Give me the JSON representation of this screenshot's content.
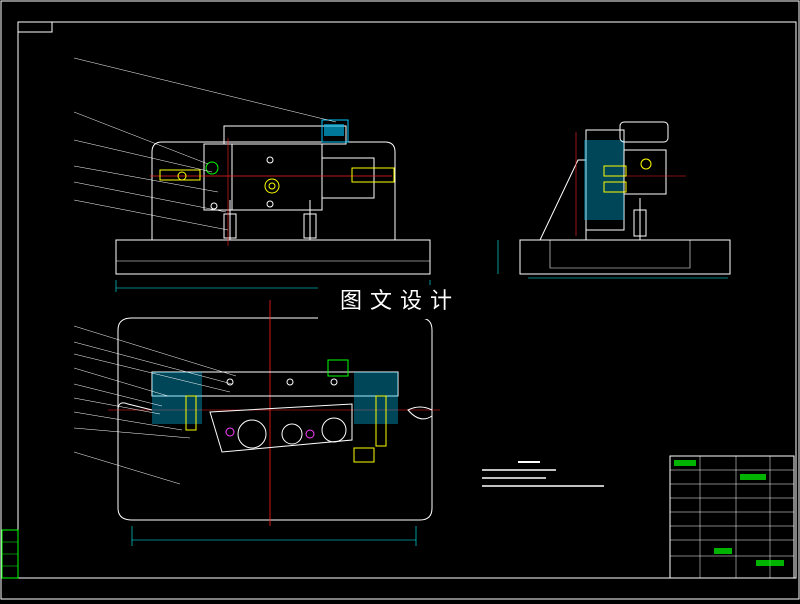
{
  "watermark": "图文设计",
  "colors": {
    "background": "#000000",
    "outline": "#ffffff",
    "dimension": "#00ffff",
    "centerline": "#ff2020",
    "part": "#ffff00",
    "hatch": "#00c8ff",
    "magenta": "#ff40ff",
    "green": "#00ff00"
  }
}
